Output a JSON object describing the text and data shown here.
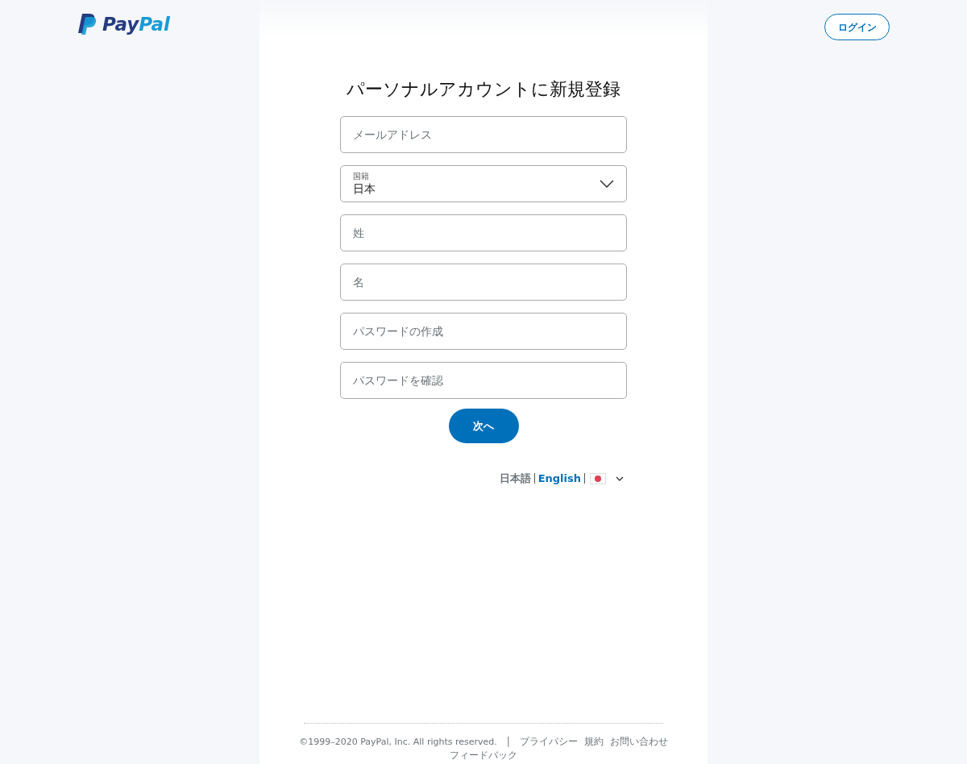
{
  "header": {
    "logo": {
      "pay": "Pay",
      "pal": "Pal"
    },
    "login_button": "ログイン"
  },
  "form": {
    "title": "パーソナルアカウントに新規登録",
    "fields": [
      {
        "kind": "text",
        "placeholder": "メールアドレス"
      },
      {
        "kind": "select",
        "label": "国籍",
        "value": "日本"
      },
      {
        "kind": "text",
        "placeholder": "姓"
      },
      {
        "kind": "text",
        "placeholder": "名"
      },
      {
        "kind": "password",
        "placeholder": "パスワードの作成"
      },
      {
        "kind": "password",
        "placeholder": "パスワードを確認"
      }
    ],
    "submit": "次へ"
  },
  "languages": [
    {
      "label": "日本語",
      "selected": true
    },
    {
      "label": "English",
      "selected": false
    }
  ],
  "footer": {
    "copyright": "©1999–2020 PayPal, Inc. All rights reserved.",
    "separator": "|",
    "links": [
      "プライバシー",
      "規約",
      "お問い合わせ",
      "フィードバック"
    ]
  }
}
